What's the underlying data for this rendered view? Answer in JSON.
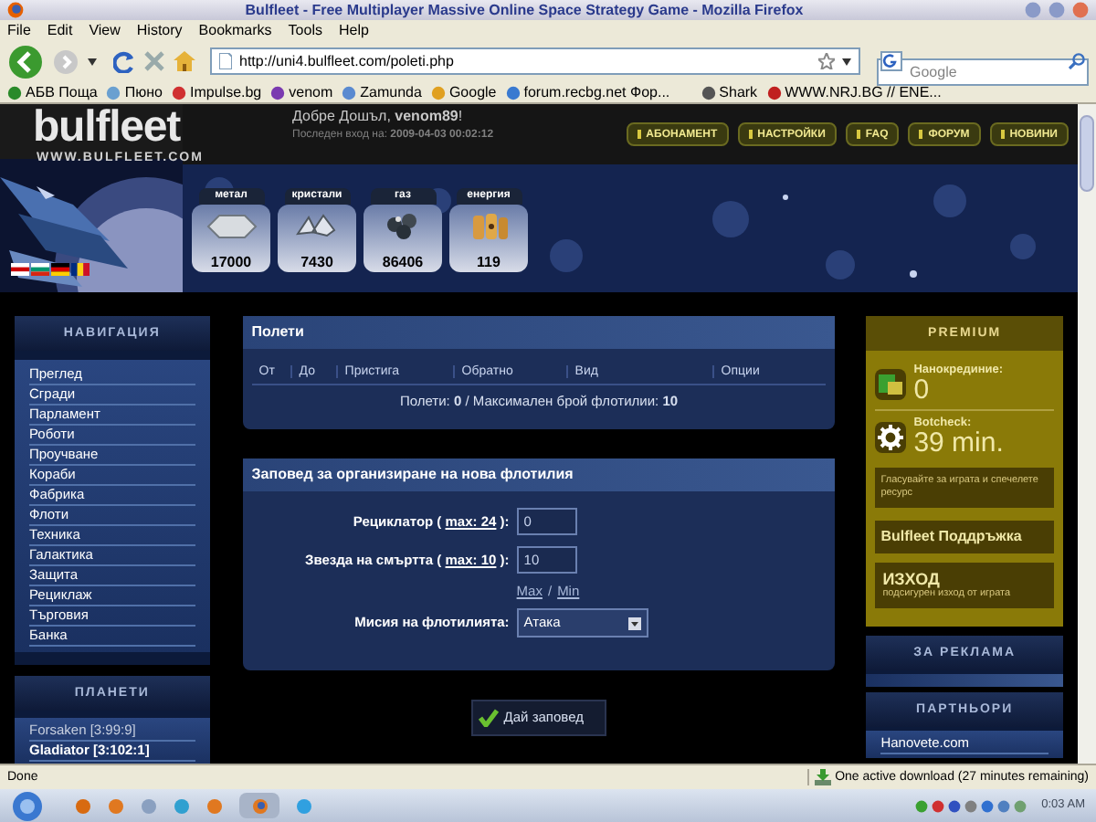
{
  "window": {
    "title": "Bulfleet - Free Multiplayer Massive Online Space Strategy Game - Mozilla Firefox"
  },
  "menu": [
    "File",
    "Edit",
    "View",
    "History",
    "Bookmarks",
    "Tools",
    "Help"
  ],
  "toolbar": {
    "url": "http://uni4.bulfleet.com/poleti.php",
    "search_placeholder": "Google"
  },
  "bookmarks": [
    "АБВ Поща",
    "Пюно",
    "Impulse.bg",
    "venom",
    "Zamunda",
    "Google",
    "forum.recbg.net Фор...",
    "Shark",
    "WWW.NRJ.BG // ENE..."
  ],
  "page": {
    "logo": {
      "name": "bulfleet",
      "site": "WWW.BULFLEET.COM"
    },
    "welcome": "Добре Дошъл, **venom89**!",
    "last_login": "Последен вход на: **2009-04-03 00:02:12**",
    "nav_buttons": [
      "АБОНАМЕНТ",
      "НАСТРОЙКИ",
      "FAQ",
      "ФОРУМ",
      "НОВИНИ"
    ],
    "resources": [
      {
        "kind": "metal",
        "label": "метал",
        "value": "17000"
      },
      {
        "kind": "crystal",
        "label": "кристали",
        "value": "7430"
      },
      {
        "kind": "gas",
        "label": "газ",
        "value": "86406"
      },
      {
        "kind": "energy",
        "label": "енергия",
        "value": "119"
      }
    ],
    "navigation": {
      "title": "НАВИГАЦИЯ",
      "items": [
        "Преглед",
        "Сгради",
        "Парламент",
        "Роботи",
        "Проучване",
        "Кораби",
        "Фабрика",
        "Флоти",
        "Техника",
        "Галактика",
        "Защита",
        "Рециклаж",
        "Търговия",
        "Банка"
      ]
    },
    "planets": {
      "title": "ПЛАНЕТИ",
      "items": [
        {
          "label": "Forsaken [3:99:9]",
          "selected": false
        },
        {
          "label": "Gladiator [3:102:1]",
          "selected": true
        }
      ]
    },
    "flights": {
      "title": "Полети",
      "columns": [
        "От",
        "До",
        "Пристига",
        "Обратно",
        "Вид",
        "Опции"
      ],
      "summary": "Полети: **0** / Максимален брой флотилии: **10**"
    },
    "order": {
      "title": "Заповед за организиране на нова флотилия",
      "ships": [
        {
          "label_before": "Рециклатор ( ",
          "link": "max: 24",
          "label_after": " ):",
          "value": "0"
        },
        {
          "label_before": "Звезда на смъртта ( ",
          "link": "max: 10",
          "label_after": " ):",
          "value": "10"
        }
      ],
      "max_link": "Max",
      "separator": "/",
      "min_link": "Min",
      "mission_label": "Мисия на флотилията:",
      "mission": "Атака",
      "submit": "Дай заповед"
    },
    "premium": {
      "title": "PREMIUM",
      "stats": [
        {
          "kind": "credits",
          "label": "Нанокрединие:",
          "value": "0"
        },
        {
          "kind": "botcheck",
          "label": "Botcheck:",
          "value": "39 min."
        }
      ],
      "vote": "Гласувайте за играта и спечелете ресурс",
      "support": "Bulfleet Поддръжка",
      "exit_title": "ИЗХОД",
      "exit_subtitle": "подсигурен изход от играта"
    },
    "ads": {
      "title": "ЗА РЕКЛАМА"
    },
    "partners": {
      "title": "ПАРТНЬОРИ",
      "items": [
        "Hanovete.com"
      ]
    }
  },
  "status_bar": {
    "text": "Done",
    "download": "One active download (27 minutes remaining)"
  },
  "taskbar": {
    "clock": "0:03 AM"
  }
}
